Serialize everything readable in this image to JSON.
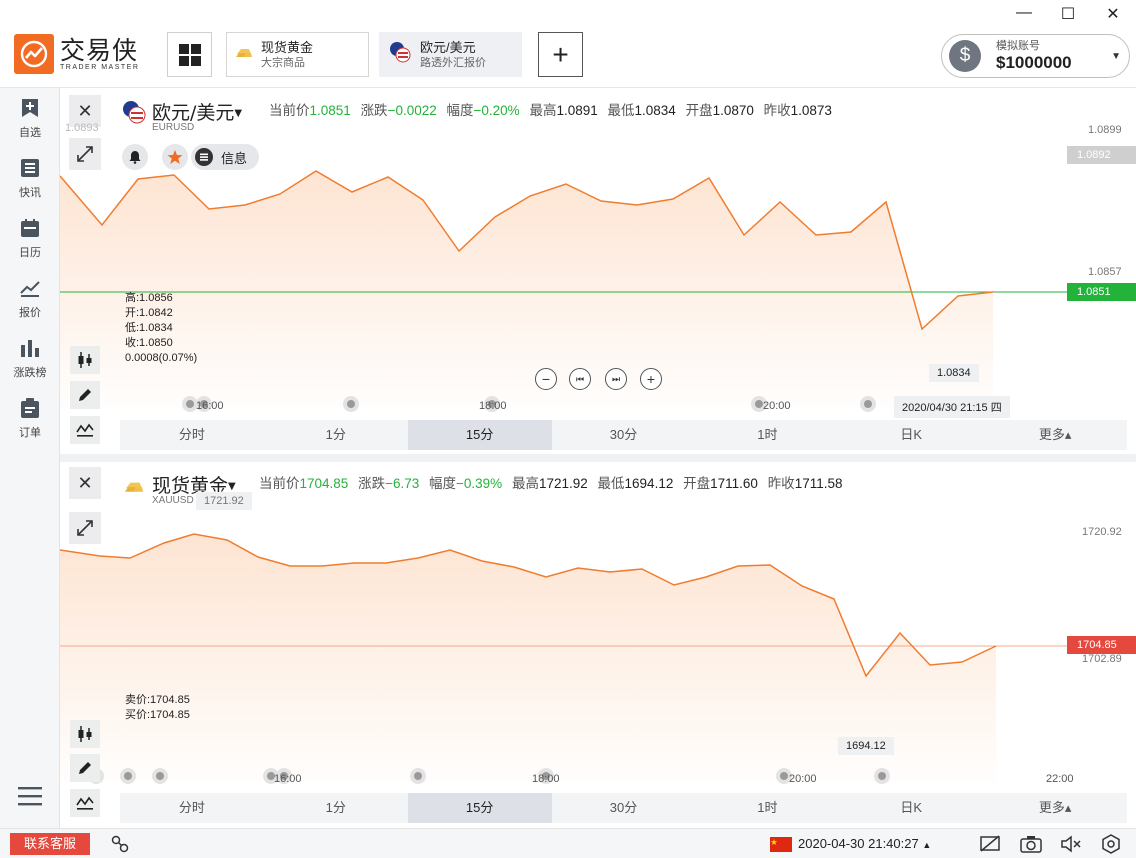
{
  "app": {
    "logo_cn": "交易侠",
    "logo_en": "TRADER MASTER"
  },
  "tabs": [
    {
      "title": "现货黄金",
      "subtitle": "大宗商品"
    },
    {
      "title": "欧元/美元",
      "subtitle": "路透外汇报价"
    }
  ],
  "account": {
    "label": "模拟账号",
    "value": "$1000000",
    "icon": "dollar-icon"
  },
  "sidebar": [
    {
      "label": "自选",
      "icon": "bookmark-plus-icon"
    },
    {
      "label": "快讯",
      "icon": "news-icon"
    },
    {
      "label": "日历",
      "icon": "calendar-icon"
    },
    {
      "label": "报价",
      "icon": "trend-line-icon"
    },
    {
      "label": "涨跌榜",
      "icon": "bar-chart-icon"
    },
    {
      "label": "订单",
      "icon": "clipboard-icon"
    }
  ],
  "periods": [
    "分时",
    "1分",
    "15分",
    "30分",
    "1时",
    "日K",
    "更多▴"
  ],
  "panel1": {
    "name": "欧元/美元",
    "code": "EURUSD",
    "quote": {
      "current_label": "当前价",
      "current": "1.0851",
      "change_label": "涨跌",
      "change": "−0.0022",
      "pct_label": "幅度",
      "pct": "−0.20%",
      "high_label": "最高",
      "high": "1.0891",
      "low_label": "最低",
      "low": "1.0834",
      "open_label": "开盘",
      "open": "1.0870",
      "prev_label": "昨收",
      "prev": "1.0873"
    },
    "info_label": "信息",
    "ohlc": [
      "高:1.0856",
      "开:1.0842",
      "低:1.0834",
      "收:1.0850",
      "0.0008(0.07%)"
    ],
    "left_partial": "1.0893",
    "axis": {
      "top": "1.0899",
      "top_tag": "1.0892",
      "mid": "1.0857",
      "price_tag": "1.0851"
    },
    "low_tooltip": "1.0834",
    "time_labels": [
      "16:00",
      "18:00",
      "20:00"
    ],
    "crosshair_time": "2020/04/30 21:15 四",
    "line_color": "#f07c2e",
    "fill_color": "#fde3d0"
  },
  "panel2": {
    "name": "现货黄金",
    "code": "XAUUSD",
    "quote": {
      "current_label": "当前价",
      "current": "1704.85",
      "change_label": "涨跌",
      "change": "−6.73",
      "pct_label": "幅度",
      "pct": "−0.39%",
      "high_label": "最高",
      "high": "1721.92",
      "low_label": "最低",
      "low": "1694.12",
      "open_label": "开盘",
      "open": "1711.60",
      "prev_label": "昨收",
      "prev": "1711.58"
    },
    "sellbuy": [
      "卖价:1704.85",
      "买价:1704.85"
    ],
    "high_tooltip": "1721.92",
    "low_tooltip": "1694.12",
    "axis": {
      "top": "1720.92",
      "price_tag": "1704.85",
      "below": "1702.89"
    },
    "time_labels": [
      "16:00",
      "18:00",
      "20:00",
      "22:00"
    ],
    "line_color": "#f07c2e",
    "fill_color": "#fde3d0"
  },
  "status": {
    "service": "联系客服",
    "datetime": "2020-04-30 21:40:27",
    "flag": "china-flag-icon"
  },
  "colors": {
    "accent": "#f26b22",
    "green": "#23b33a",
    "red": "#e5483d"
  }
}
